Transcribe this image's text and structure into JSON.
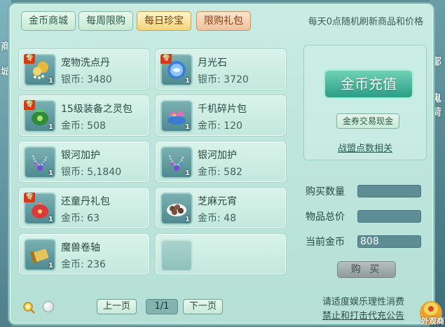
{
  "tabs": [
    {
      "label": "金币商城",
      "state": "normal"
    },
    {
      "label": "每周限购",
      "state": "normal"
    },
    {
      "label": "每日珍宝",
      "state": "active"
    },
    {
      "label": "限购礼包",
      "state": "gift"
    }
  ],
  "notice": "每天0点随机刷新商品和价格",
  "special_badge": "专",
  "items": [
    {
      "name": "宠物洗点丹",
      "price": "银币: 3480",
      "qty": "1",
      "special": true,
      "icon": "pet-pill-icon"
    },
    {
      "name": "月光石",
      "price": "银币: 3720",
      "qty": "1",
      "special": true,
      "icon": "moonstone-icon"
    },
    {
      "name": "15级装备之灵包",
      "price": "金币: 508",
      "qty": "1",
      "special": true,
      "icon": "equipment-spirit-bag-icon"
    },
    {
      "name": "千机碎片包",
      "price": "金币: 120",
      "qty": "1",
      "special": false,
      "icon": "fragment-bag-icon"
    },
    {
      "name": "银河加护",
      "price": "银币: 5,1840",
      "qty": "1",
      "special": false,
      "icon": "galaxy-necklace-icon"
    },
    {
      "name": "银河加护",
      "price": "金币: 582",
      "qty": "1",
      "special": false,
      "icon": "galaxy-necklace-icon"
    },
    {
      "name": "还童丹礼包",
      "price": "金币: 63",
      "qty": "1",
      "special": true,
      "icon": "rejuvenation-pill-bag-icon"
    },
    {
      "name": "芝麻元宵",
      "price": "金币: 48",
      "qty": "1",
      "special": false,
      "icon": "sesame-dumpling-icon"
    },
    {
      "name": "魔兽卷轴",
      "price": "金币: 236",
      "qty": "1",
      "special": false,
      "icon": "beast-scroll-icon"
    }
  ],
  "recharge_button": "金币充值",
  "coupon_button": "金券交易现金",
  "alliance_link": "战盟点数相关",
  "fields": {
    "quantity_label": "购买数量",
    "quantity_value": "",
    "total_label": "物品总价",
    "total_value": "",
    "gold_label": "当前金币",
    "gold_value": "808"
  },
  "buy_button": "购 买",
  "pager": {
    "prev": "上一页",
    "page": "1/1",
    "next": "下一页"
  },
  "compliance": {
    "line1": "请适度娱乐理性消费",
    "line2": "禁止和打击代充公告"
  },
  "outside_label": "外观商",
  "edge_text": {
    "left_top": "商",
    "left_mid": "城",
    "right_top": "鄞",
    "right_mid": "鬼",
    "right_low": "荷"
  },
  "colors": {
    "accent": "#2c9d86",
    "active_tab": "#f2d57d",
    "price_text": "#3d6460"
  }
}
